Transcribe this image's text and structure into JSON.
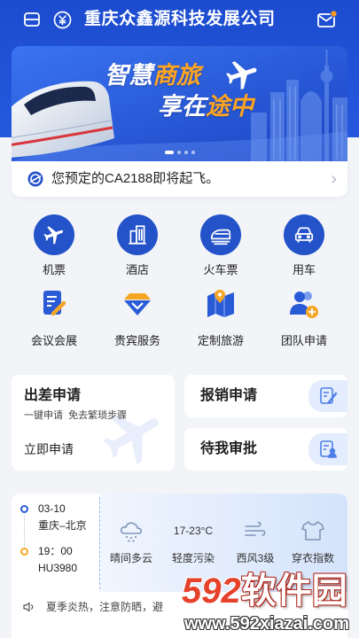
{
  "colors": {
    "primary": "#2352c9",
    "header": "#1f52d6",
    "accent": "#f5a623",
    "background": "#f2f4f8"
  },
  "header": {
    "title": "重庆众鑫源科技发展公司",
    "left_icons": [
      "card-icon",
      "yuan-icon"
    ],
    "right_icon": "mail-icon",
    "has_unread": true
  },
  "banner": {
    "slogan_line1": {
      "normal": "智慧",
      "highlight": "商旅"
    },
    "slogan_line2": {
      "normal": "享在",
      "highlight": "途中"
    },
    "slide_count": 4,
    "active_slide": 0
  },
  "notice": {
    "icon": "clock-icon",
    "text": "您预定的CA2188即将起飞。"
  },
  "services": {
    "row1": [
      {
        "label": "机票",
        "icon": "plane-icon"
      },
      {
        "label": "酒店",
        "icon": "building-icon"
      },
      {
        "label": "火车票",
        "icon": "train-icon"
      },
      {
        "label": "用车",
        "icon": "car-icon"
      }
    ],
    "row2": [
      {
        "label": "会议会展",
        "icon": "document-pen-icon"
      },
      {
        "label": "贵宾服务",
        "icon": "diamond-icon"
      },
      {
        "label": "定制旅游",
        "icon": "map-pin-icon"
      },
      {
        "label": "团队申请",
        "icon": "team-add-icon"
      }
    ]
  },
  "cards": {
    "trip_request": {
      "title": "出差申请",
      "subtitle": "一键申请  免去繁琐步骤",
      "action": "立即申请"
    },
    "expense": {
      "title": "报销申请",
      "icon": "expense-form-icon"
    },
    "approval": {
      "title": "待我审批",
      "icon": "approval-form-icon"
    }
  },
  "trip": {
    "date": "03-10",
    "route": "重庆–北京",
    "time": "19：00",
    "flight": "HU3980"
  },
  "weather": {
    "condition": {
      "label": "晴间多云",
      "icon": "cloud-rain-icon"
    },
    "air": {
      "value": "17-23°C",
      "label": "轻度污染"
    },
    "wind": {
      "label": "西风3级",
      "icon": "wind-icon"
    },
    "clothing": {
      "label": "穿衣指数",
      "icon": "shirt-icon"
    }
  },
  "tip": {
    "icon": "speaker-icon",
    "text": "夏季炎热，注意防晒，避"
  },
  "watermark": {
    "number": "592",
    "name": "软件园",
    "url": "www.592xiazai.com"
  }
}
